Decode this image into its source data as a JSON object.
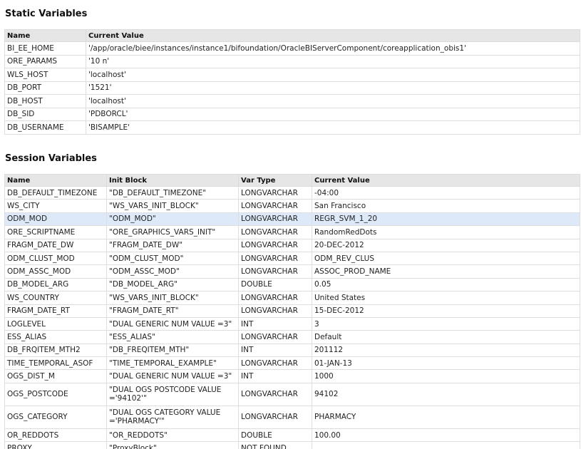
{
  "static_section": {
    "title": "Static Variables",
    "headers": [
      "Name",
      "Current Value"
    ],
    "rows": [
      [
        "BI_EE_HOME",
        "'/app/oracle/biee/instances/instance1/bifoundation/OracleBIServerComponent/coreapplication_obis1'"
      ],
      [
        "ORE_PARAMS",
        "'10 n'"
      ],
      [
        "WLS_HOST",
        "'localhost'"
      ],
      [
        "DB_PORT",
        "'1521'"
      ],
      [
        "DB_HOST",
        "'localhost'"
      ],
      [
        "DB_SID",
        "'PDBORCL'"
      ],
      [
        "DB_USERNAME",
        "'BISAMPLE'"
      ]
    ]
  },
  "session_section": {
    "title": "Session Variables",
    "headers": [
      "Name",
      "Init Block",
      "Var Type",
      "Current Value"
    ],
    "rows": [
      [
        "DB_DEFAULT_TIMEZONE",
        "\"DB_DEFAULT_TIMEZONE\"",
        "LONGVARCHAR",
        "-04:00"
      ],
      [
        "WS_CITY",
        "\"WS_VARS_INIT_BLOCK\"",
        "LONGVARCHAR",
        "San Francisco"
      ],
      [
        "ODM_MOD",
        "\"ODM_MOD\"",
        "LONGVARCHAR",
        "REGR_SVM_1_20"
      ],
      [
        "ORE_SCRIPTNAME",
        "\"ORE_GRAPHICS_VARS_INIT\"",
        "LONGVARCHAR",
        "RandomRedDots"
      ],
      [
        "FRAGM_DATE_DW",
        "\"FRAGM_DATE_DW\"",
        "LONGVARCHAR",
        "20-DEC-2012"
      ],
      [
        "ODM_CLUST_MOD",
        "\"ODM_CLUST_MOD\"",
        "LONGVARCHAR",
        "ODM_REV_CLUS"
      ],
      [
        "ODM_ASSC_MOD",
        "\"ODM_ASSC_MOD\"",
        "LONGVARCHAR",
        "ASSOC_PROD_NAME"
      ],
      [
        "DB_MODEL_ARG",
        "\"DB_MODEL_ARG\"",
        "DOUBLE",
        "0.05"
      ],
      [
        "WS_COUNTRY",
        "\"WS_VARS_INIT_BLOCK\"",
        "LONGVARCHAR",
        "United States"
      ],
      [
        "FRAGM_DATE_RT",
        "\"FRAGM_DATE_RT\"",
        "LONGVARCHAR",
        "15-DEC-2012"
      ],
      [
        "LOGLEVEL",
        "\"DUAL GENERIC NUM VALUE =3\"",
        "INT",
        "3"
      ],
      [
        "ESS_ALIAS",
        "\"ESS_ALIAS\"",
        "LONGVARCHAR",
        "Default"
      ],
      [
        "DB_FRQITEM_MTH2",
        "\"DB_FREQITEM_MTH\"",
        "INT",
        "201112"
      ],
      [
        "TIME_TEMPORAL_ASOF",
        "\"TIME_TEMPORAL_EXAMPLE\"",
        "LONGVARCHAR",
        "01-JAN-13"
      ],
      [
        "OGS_DIST_M",
        "\"DUAL GENERIC NUM VALUE =3\"",
        "INT",
        "1000"
      ],
      [
        "OGS_POSTCODE",
        "\"DUAL OGS POSTCODE VALUE ='94102'\"",
        "LONGVARCHAR",
        "94102"
      ],
      [
        "OGS_CATEGORY",
        "\"DUAL OGS CATEGORY VALUE ='PHARMACY'\"",
        "LONGVARCHAR",
        "PHARMACY"
      ],
      [
        "OR_REDDOTS",
        "\"OR_REDDOTS\"",
        "DOUBLE",
        "100.00"
      ],
      [
        "PROXY",
        "\"ProxyBlock\"",
        "NOT FOUND",
        ""
      ]
    ],
    "highlighted_row_index": 2
  },
  "colors": {
    "header_bg": "#e6e6e6",
    "highlight_row": "#dde9f8",
    "border": "#dedede"
  }
}
